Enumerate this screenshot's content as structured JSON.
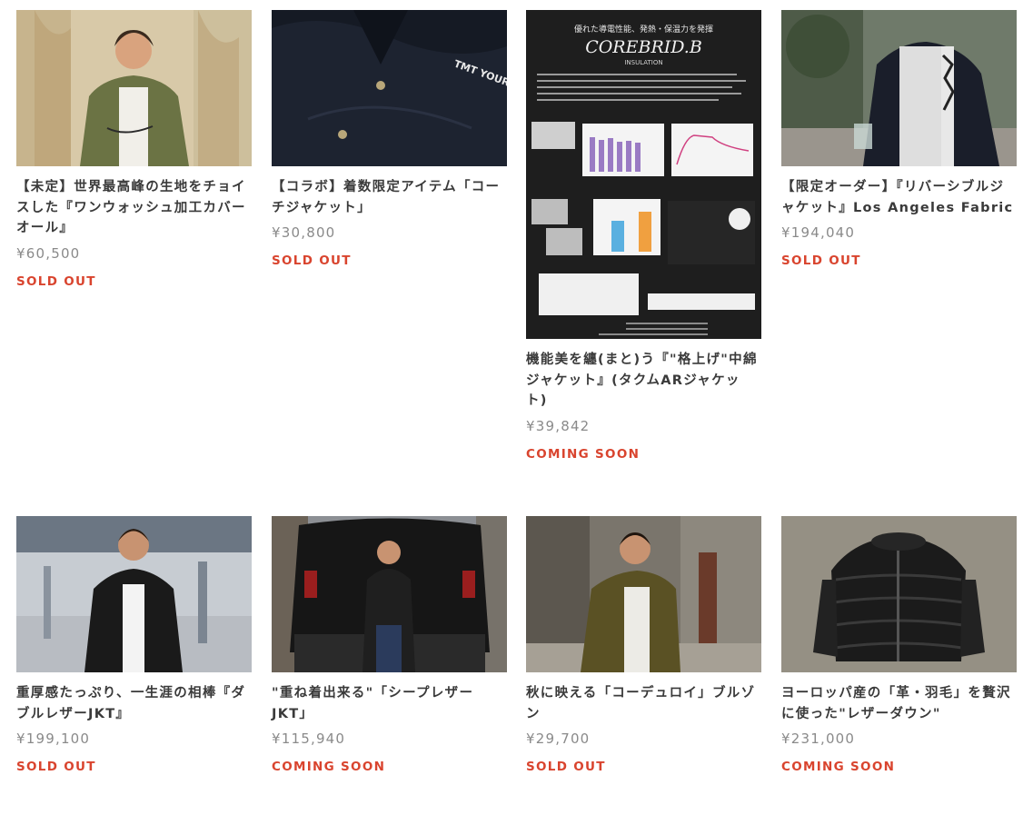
{
  "products": [
    {
      "title": "【未定】世界最高峰の生地をチョイスした『ワンウォッシュ加工カバーオール』",
      "price": "¥60,500",
      "status": "SOLD OUT"
    },
    {
      "title": "【コラボ】着数限定アイテム「コーチジャケット」",
      "price": "¥30,800",
      "status": "SOLD OUT",
      "image_text": "TMT YOURS"
    },
    {
      "title": "機能美を纏(まと)う『\"格上げ\"中綿ジャケット』(タクムARジャケット)",
      "price": "¥39,842",
      "status": "COMING SOON",
      "image_text": {
        "heading": "優れた導電性能、発熱・保温力を発揮",
        "logo": "COREBRID.B",
        "sub": "INSULATION"
      }
    },
    {
      "title": "【限定オーダー】『リバーシブルジャケット』Los Angeles Fabric",
      "price": "¥194,040",
      "status": "SOLD OUT"
    },
    {
      "title": "重厚感たっぷり、一生涯の相棒『ダブルレザーJKT』",
      "price": "¥199,100",
      "status": "SOLD OUT"
    },
    {
      "title": "\"重ね着出来る\"「シープレザーJKT」",
      "price": "¥115,940",
      "status": "COMING SOON"
    },
    {
      "title": "秋に映える「コーデュロイ」ブルゾン",
      "price": "¥29,700",
      "status": "SOLD OUT"
    },
    {
      "title": "ヨーロッパ産の「革・羽毛」を贅沢に使った\"レザーダウン\"",
      "price": "¥231,000",
      "status": "COMING SOON"
    }
  ],
  "colors": {
    "status": "#d9442e",
    "price": "#8a8a8a",
    "title": "#3a3a3a"
  }
}
